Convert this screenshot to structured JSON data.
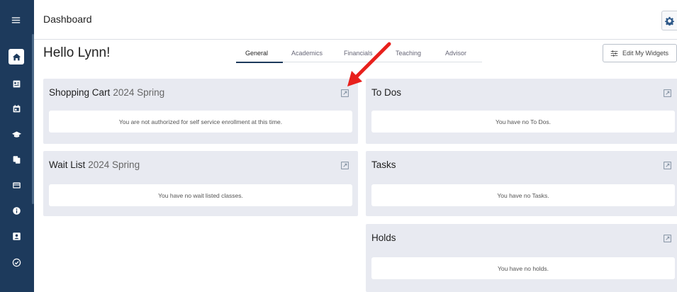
{
  "header": {
    "title": "Dashboard"
  },
  "greeting": "Hello Lynn!",
  "tabs": [
    {
      "label": "General",
      "active": true
    },
    {
      "label": "Academics",
      "active": false
    },
    {
      "label": "Financials",
      "active": false
    },
    {
      "label": "Teaching",
      "active": false
    },
    {
      "label": "Advisor",
      "active": false
    }
  ],
  "edit_widgets_label": "Edit My Widgets",
  "sidebar": {
    "items": [
      {
        "icon": "home-icon",
        "active": true
      },
      {
        "icon": "id-card-icon",
        "active": false
      },
      {
        "icon": "calendar-icon",
        "active": false
      },
      {
        "icon": "graduation-cap-icon",
        "active": false
      },
      {
        "icon": "documents-icon",
        "active": false
      },
      {
        "icon": "credit-card-icon",
        "active": false
      },
      {
        "icon": "info-icon",
        "active": false
      },
      {
        "icon": "contact-card-icon",
        "active": false
      },
      {
        "icon": "check-circle-icon",
        "active": false
      }
    ]
  },
  "widgets": {
    "shopping_cart": {
      "title": "Shopping Cart",
      "term": "2024 Spring",
      "message": "You are not authorized for self service enrollment at this time."
    },
    "wait_list": {
      "title": "Wait List",
      "term": "2024 Spring",
      "message": "You have no wait listed classes."
    },
    "todos": {
      "title": "To Dos",
      "message": "You have no To Dos."
    },
    "tasks": {
      "title": "Tasks",
      "message": "You have no Tasks."
    },
    "holds": {
      "title": "Holds",
      "message": "You have no holds."
    }
  },
  "colors": {
    "sidebar": "#1d3a5c",
    "card_bg": "#e8eaf1",
    "annotation_arrow": "#e8201c"
  }
}
